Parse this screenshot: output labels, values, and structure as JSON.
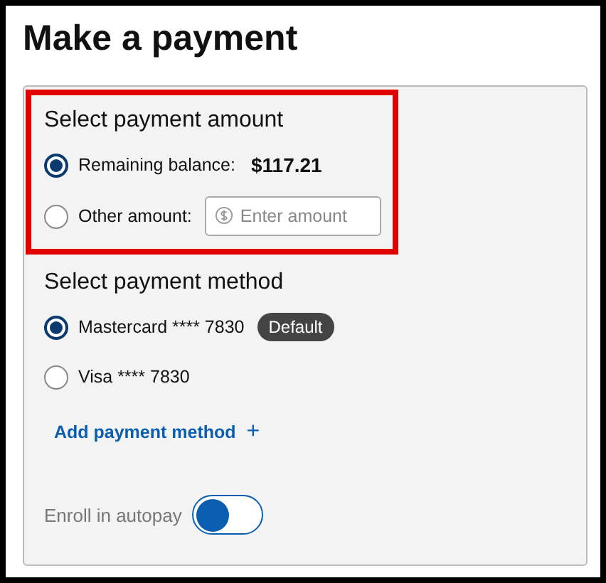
{
  "title": "Make a payment",
  "amount_section": {
    "highlighted": true,
    "heading": "Select payment amount",
    "options": [
      {
        "kind": "balance",
        "label": "Remaining balance:",
        "value": "$117.21",
        "selected": true
      },
      {
        "kind": "input",
        "label": "Other amount:",
        "placeholder": "Enter amount",
        "selected": false
      }
    ]
  },
  "method_section": {
    "heading": "Select payment method",
    "options": [
      {
        "label": "Mastercard **** 7830",
        "badge": "Default",
        "selected": true
      },
      {
        "label": "Visa **** 7830",
        "selected": false
      }
    ],
    "add_link": {
      "label": "Add payment method",
      "icon": "+"
    }
  },
  "autopay": {
    "label": "Enroll in autopay",
    "on": false
  }
}
